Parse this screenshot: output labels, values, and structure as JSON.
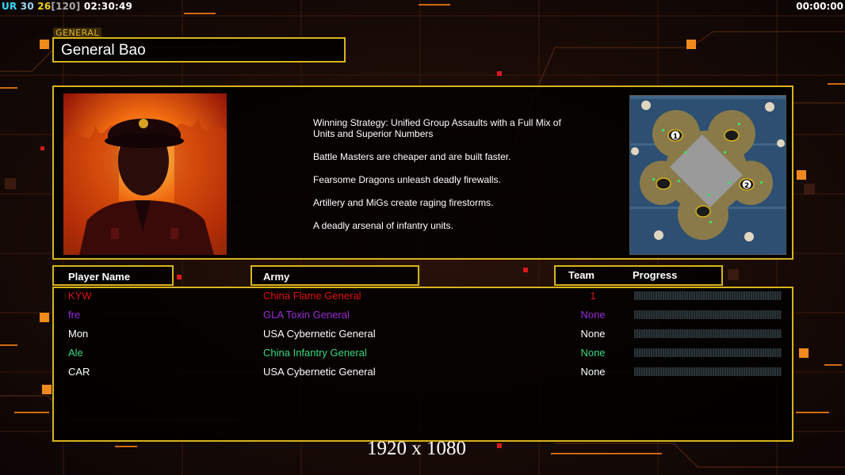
{
  "hud": {
    "left_prefix": "UR",
    "left_a": "30",
    "left_b": "26",
    "left_c": "[120]",
    "left_time": "02:30:49",
    "right_time": "00:00:00"
  },
  "general": {
    "tag": "GENERAL",
    "name": "General Bao",
    "description": [
      "Winning Strategy: Unified Group Assaults with a Full Mix of Units and Superior Numbers",
      "Battle Masters are cheaper and are built faster.",
      "Fearsome Dragons unleash deadly firewalls.",
      "Artillery and MiGs create raging firestorms.",
      "A deadly arsenal of infantry units."
    ]
  },
  "table_headers": {
    "player": "Player Name",
    "army": "Army",
    "team": "Team",
    "progress": "Progress"
  },
  "players": [
    {
      "name": "KYW",
      "army": "China Flame General",
      "team": "1",
      "color": "#e01010",
      "progress": 0
    },
    {
      "name": "fre",
      "army": "GLA Toxin General",
      "team": "None",
      "color": "#9a2ad8",
      "progress": 0
    },
    {
      "name": "Mon",
      "army": "USA Cybernetic General",
      "team": "None",
      "color": "#ffffff",
      "progress": 0
    },
    {
      "name": "Ale",
      "army": "China Infantry General",
      "team": "None",
      "color": "#3ad880",
      "progress": 0
    },
    {
      "name": "CAR",
      "army": "USA Cybernetic General",
      "team": "None",
      "color": "#ffffff",
      "progress": 0
    }
  ],
  "map": {
    "start_labels": [
      "1",
      "2"
    ]
  },
  "watermark": "1920 x 1080",
  "colors": {
    "accent": "#d8b41c",
    "hud_orange": "#f08a1c"
  }
}
